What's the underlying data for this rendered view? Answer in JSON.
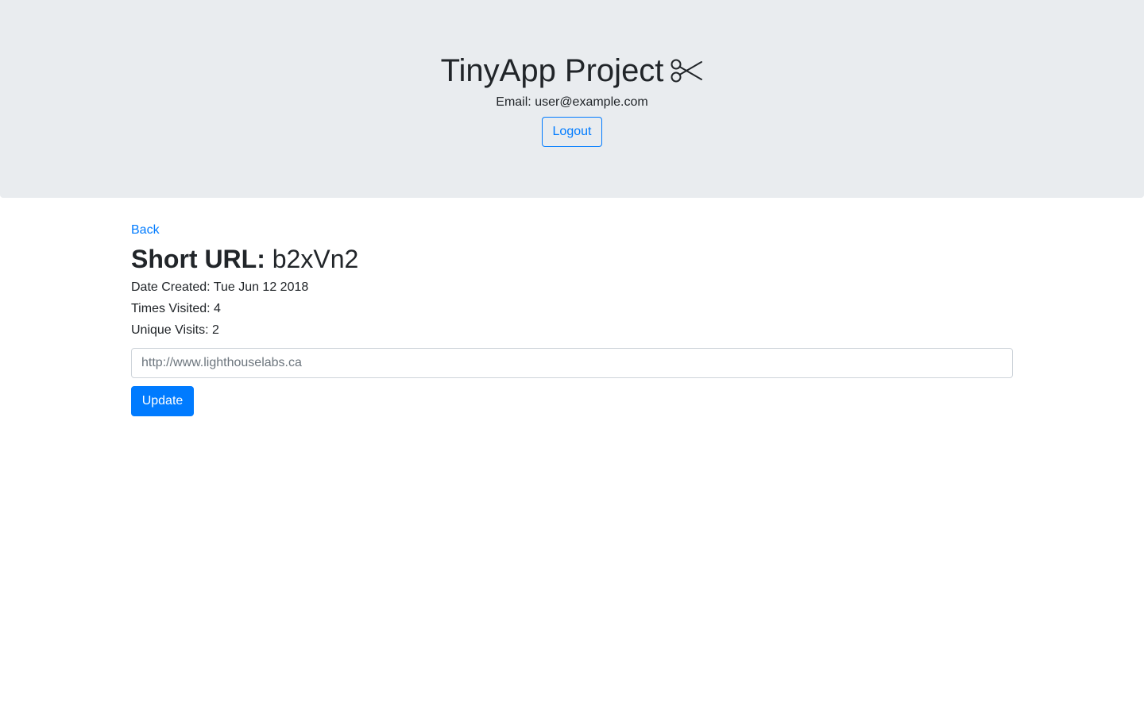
{
  "header": {
    "title": "TinyApp Project",
    "title_icon": "scissors-icon",
    "email_label": "Email:",
    "email": "user@example.com",
    "logout_label": "Logout"
  },
  "main": {
    "back_label": "Back",
    "short_url_label": "Short URL:",
    "short_url": "b2xVn2",
    "date_created": "Date Created: Tue Jun 12 2018",
    "times_visited": "Times Visited: 4",
    "unique_visits": "Unique Visits: 2",
    "long_url_placeholder": "http://www.lighthouselabs.ca",
    "update_label": "Update"
  },
  "colors": {
    "primary": "#007bff",
    "jumbotron_bg": "#e9ecef",
    "text": "#212529"
  }
}
